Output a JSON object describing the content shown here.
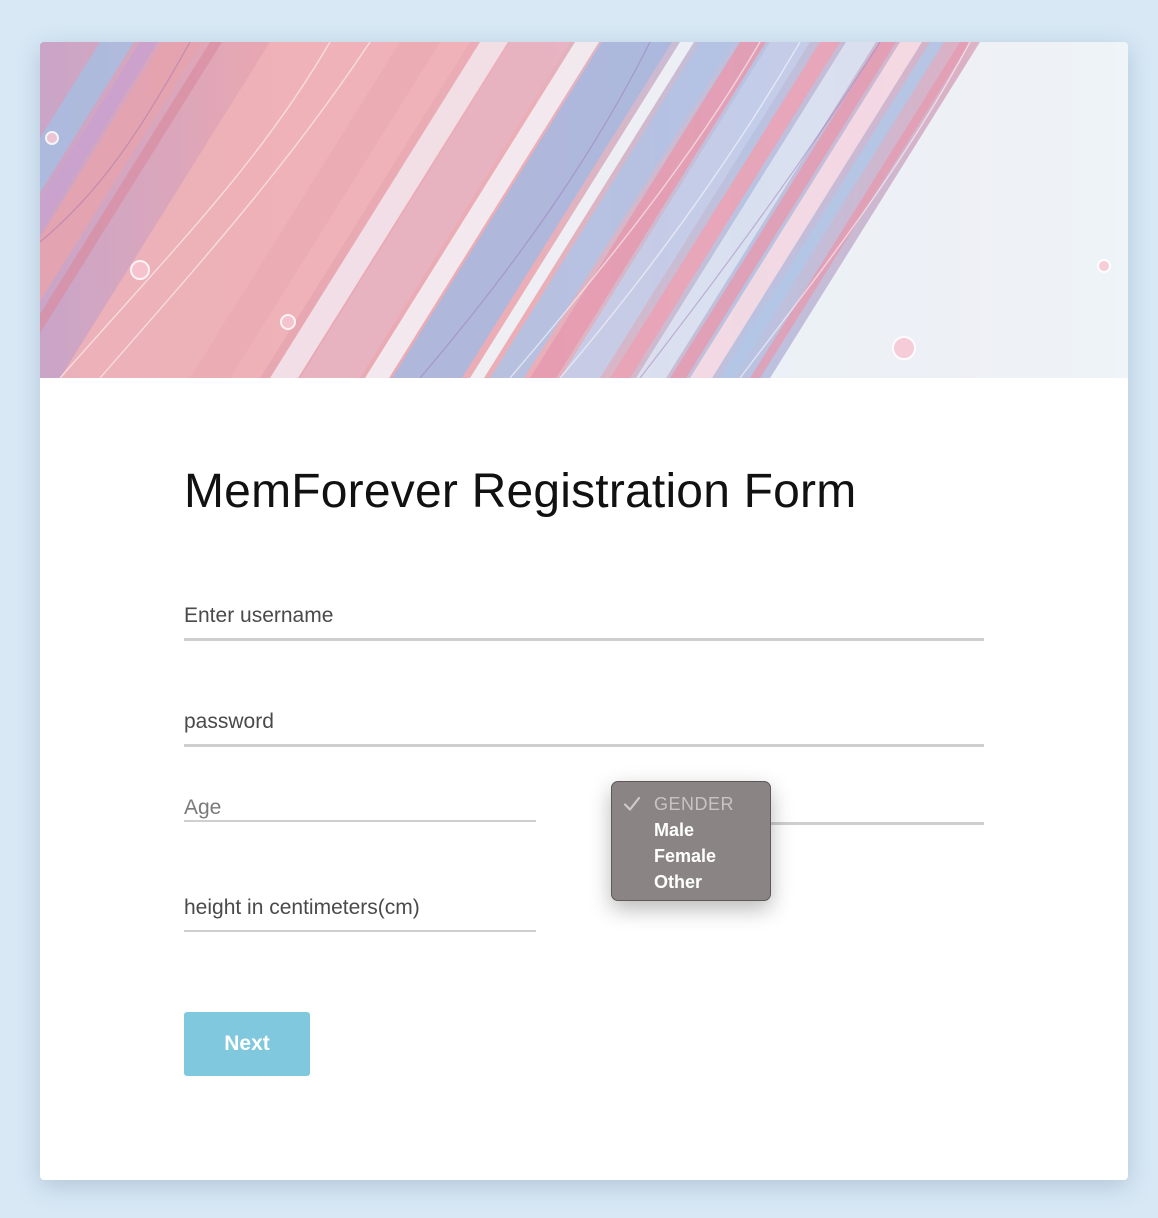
{
  "form": {
    "title": "MemForever Registration Form",
    "username_placeholder": "Enter username",
    "password_placeholder": "password",
    "age_placeholder": "Age",
    "height_placeholder": "height in centimeters(cm)",
    "gender": {
      "header": "GENDER",
      "options": [
        "Male",
        "Female",
        "Other"
      ]
    },
    "next_label": "Next"
  },
  "colors": {
    "page_background": "#d8e8f5",
    "button": "#80c8dd",
    "dropdown_background": "#8b8484"
  },
  "icons": {
    "dropdown_selected": "checkmark-icon"
  }
}
